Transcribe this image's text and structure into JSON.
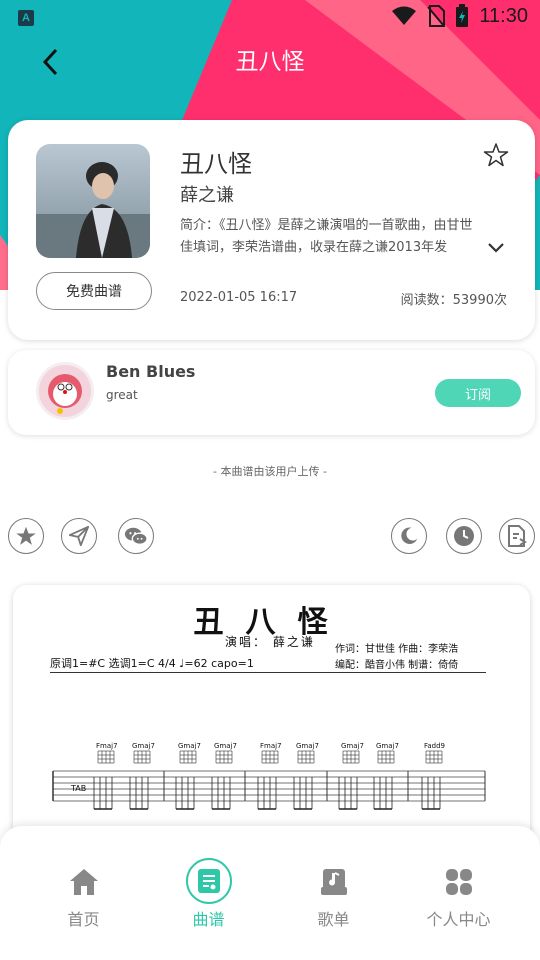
{
  "status_bar": {
    "time": "11:30",
    "app_icon": "A"
  },
  "header": {
    "title": "丑八怪"
  },
  "song": {
    "title": "丑八怪",
    "artist": "薛之谦",
    "description": "简介：《丑八怪》是薛之谦演唱的一首歌曲，由甘世佳填词，李荣浩谱曲，收录在薛之谦2013年发",
    "free_button": "免费曲谱",
    "date": "2022-01-05 16:17",
    "reads": "阅读数：53990次"
  },
  "uploader": {
    "name": "Ben Blues",
    "signature": "great",
    "subscribe_label": "订阅"
  },
  "upload_note": "- 本曲谱由该用户上传 -",
  "actions": {
    "left": [
      "star-icon",
      "send-icon",
      "wechat-icon"
    ],
    "right": [
      "moon-icon",
      "clock-icon",
      "export-icon"
    ]
  },
  "score": {
    "title": "丑八怪",
    "singer": "演唱： 薛之谦",
    "lyric_composer": "作词：甘世佳  作曲：李荣浩",
    "arranger": "编配：酷音小伟  制谱：倚倚",
    "key_line": "原调1=#C 选调1=C  4/4  ♩=62   capo=1",
    "chords": [
      "Fmaj7",
      "Gmaj7",
      "Gmaj7",
      "Gmaj7",
      "Fmaj7",
      "Gmaj7",
      "Gmaj7",
      "Gmaj7",
      "Fadd9"
    ]
  },
  "bottom_nav": [
    {
      "label": "首页",
      "icon": "home-icon"
    },
    {
      "label": "曲谱",
      "icon": "score-icon"
    },
    {
      "label": "歌单",
      "icon": "playlist-icon"
    },
    {
      "label": "个人中心",
      "icon": "profile-icon"
    }
  ],
  "colors": {
    "teal": "#12b5b9",
    "pink": "#ff2f6e",
    "accent_green": "#2ec8a9",
    "subscribe_green": "#4fd6b7"
  }
}
